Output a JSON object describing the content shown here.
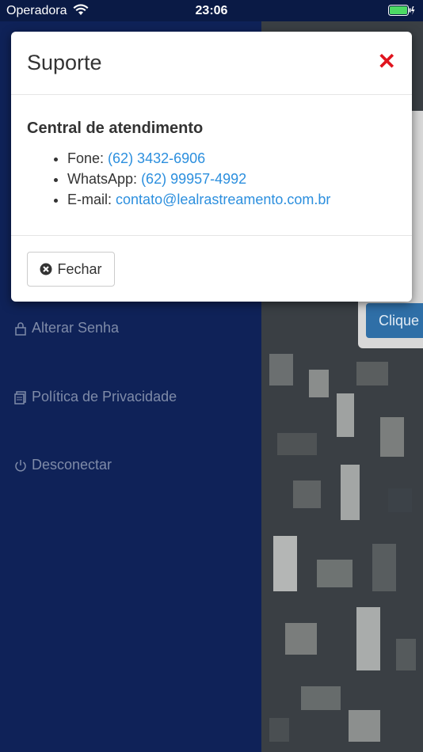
{
  "status_bar": {
    "carrier": "Operadora",
    "time": "23:06"
  },
  "drawer": {
    "items": [
      {
        "label": "Alterar Senha",
        "icon": "lock-icon"
      },
      {
        "label": "Política de Privacidade",
        "icon": "document-icon"
      },
      {
        "label": "Desconectar",
        "icon": "power-icon"
      }
    ]
  },
  "background_panel": {
    "button_label": "Clique"
  },
  "modal": {
    "title": "Suporte",
    "heading": "Central de atendimento",
    "contacts": [
      {
        "label": "Fone:",
        "value": "(62) 3432-6906"
      },
      {
        "label": "WhatsApp:",
        "value": "(62) 99957-4992"
      },
      {
        "label": "E-mail:",
        "value": "contato@lealrastreamento.com.br"
      }
    ],
    "close_button_label": "Fechar"
  },
  "colors": {
    "drawer_bg": "#0f2258",
    "link": "#2c8fde",
    "close_x": "#e0141e"
  }
}
